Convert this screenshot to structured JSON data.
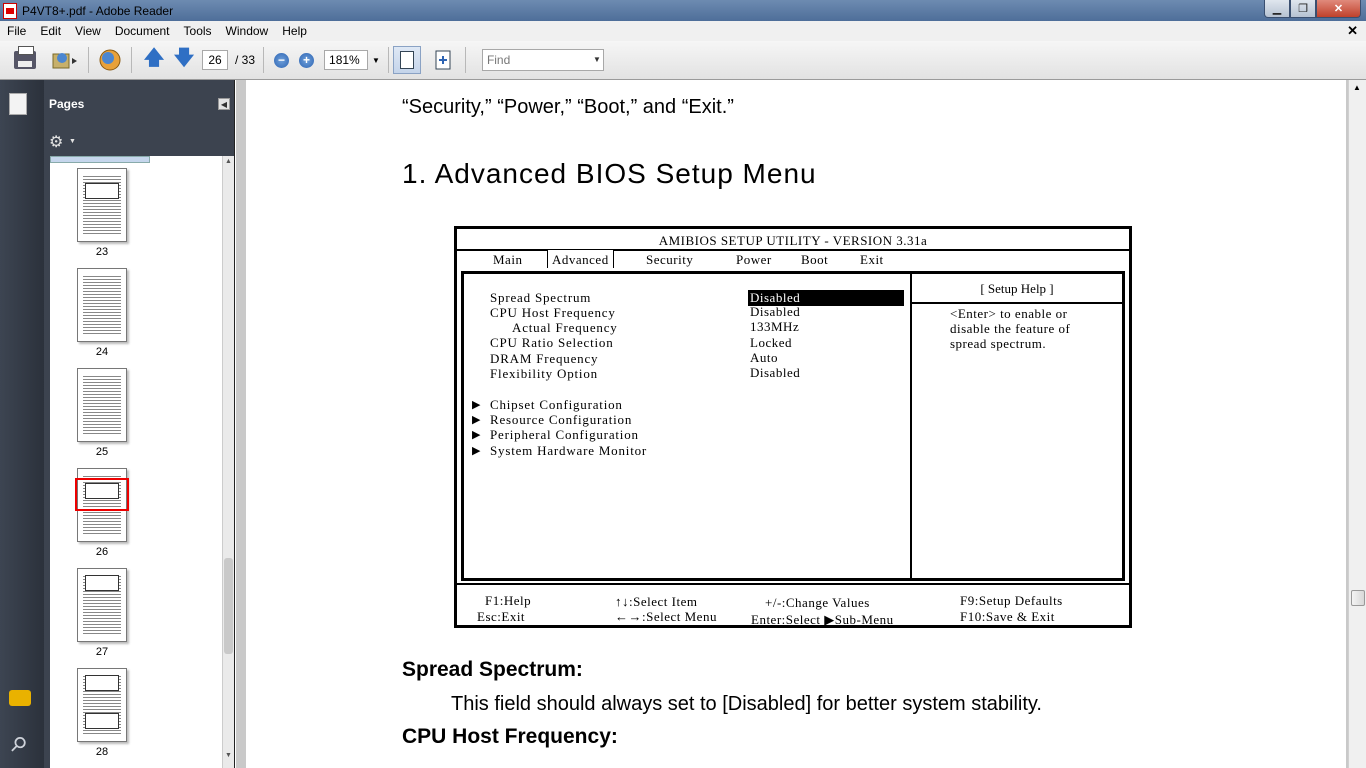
{
  "window": {
    "title": "P4VT8+.pdf - Adobe Reader",
    "minimize": "▁",
    "maximize": "❐",
    "close": "✕"
  },
  "menu": {
    "items": [
      "File",
      "Edit",
      "View",
      "Document",
      "Tools",
      "Window",
      "Help"
    ],
    "doc_close": "✕"
  },
  "toolbar": {
    "page_current": "26",
    "page_total": "/ 33",
    "zoom": "181%",
    "find_placeholder": "Find",
    "zoom_out": "−",
    "zoom_in": "+"
  },
  "pages_panel": {
    "title": "Pages",
    "thumbnails": [
      {
        "label": "23",
        "current": false,
        "figure": true
      },
      {
        "label": "24",
        "current": false,
        "figure": false
      },
      {
        "label": "25",
        "current": false,
        "figure": false
      },
      {
        "label": "26",
        "current": true,
        "figure": true
      },
      {
        "label": "27",
        "current": false,
        "figure": true
      },
      {
        "label": "28",
        "current": false,
        "figure": true
      }
    ]
  },
  "document": {
    "lead_text": "“Security,” “Power,” “Boot,” and “Exit.”",
    "heading": "1. Advanced BIOS Setup Menu",
    "bios": {
      "title": "AMIBIOS SETUP UTILITY - VERSION 3.31a",
      "tabs": [
        "Main",
        "Advanced",
        "Security",
        "Power",
        "Boot",
        "Exit"
      ],
      "active_tab": "Advanced",
      "items": [
        {
          "label": "Spread Spectrum",
          "value": "Disabled",
          "selected": true,
          "indent": false
        },
        {
          "label": "CPU Host Frequency",
          "value": "Disabled",
          "selected": false,
          "indent": false
        },
        {
          "label": "Actual Frequency",
          "value": "133MHz",
          "selected": false,
          "indent": true
        },
        {
          "label": "CPU Ratio Selection",
          "value": "Locked",
          "selected": false,
          "indent": false
        },
        {
          "label": "DRAM Frequency",
          "value": "Auto",
          "selected": false,
          "indent": false
        },
        {
          "label": "Flexibility Option",
          "value": "Disabled",
          "selected": false,
          "indent": false
        }
      ],
      "submenus": [
        "Chipset Configuration",
        "Resource Configuration",
        "Peripheral Configuration",
        "System Hardware Monitor"
      ],
      "help_title": "[   Setup Help   ]",
      "help_lines": [
        "<Enter> to enable or",
        "disable the feature of",
        "spread spectrum."
      ],
      "footer": {
        "f1": "F1:Help",
        "esc": "Esc:Exit",
        "select_item": "↑↓:Select Item",
        "select_menu": "←→:Select Menu",
        "change_values": "+/-:Change Values",
        "enter_select": "Enter:Select  ▶Sub-Menu",
        "f9": "F9:Setup Defaults",
        "f10": "F10:Save & Exit"
      }
    },
    "section1_title": "Spread Spectrum:",
    "section1_text": "This field should always set to [Disabled] for better system stability.",
    "section2_title": "CPU Host Frequency:"
  }
}
